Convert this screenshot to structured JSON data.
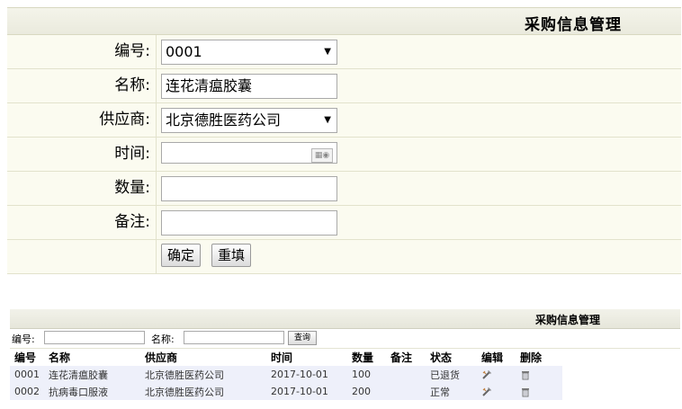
{
  "form": {
    "title": "采购信息管理",
    "fields": [
      {
        "label": "编号:",
        "type": "select",
        "value": "0001"
      },
      {
        "label": "名称:",
        "type": "text",
        "value": "连花清瘟胶囊"
      },
      {
        "label": "供应商:",
        "type": "select",
        "value": "北京德胜医药公司"
      },
      {
        "label": "时间:",
        "type": "date",
        "value": ""
      },
      {
        "label": "数量:",
        "type": "text",
        "value": ""
      },
      {
        "label": "备注:",
        "type": "text",
        "value": ""
      }
    ],
    "buttons": {
      "confirm": "确定",
      "reset": "重填"
    }
  },
  "list": {
    "title": "采购信息管理",
    "search": {
      "id_label": "编号:",
      "name_label": "名称:",
      "query_button": "查询"
    },
    "columns": [
      "编号",
      "名称",
      "供应商",
      "时间",
      "数量",
      "备注",
      "状态",
      "编辑",
      "删除"
    ],
    "rows": [
      {
        "id": "0001",
        "name": "连花清瘟胶囊",
        "supplier": "北京德胜医药公司",
        "time": "2017-10-01",
        "qty": "100",
        "note": "",
        "status": "已退货"
      },
      {
        "id": "0002",
        "name": "抗病毒口服液",
        "supplier": "北京德胜医药公司",
        "time": "2017-10-01",
        "qty": "200",
        "note": "",
        "status": "正常"
      }
    ]
  },
  "icons": {
    "select_arrow": "chevron-down-icon",
    "date_picker": "calendar-icon",
    "edit": "edit-icon",
    "delete": "trash-icon"
  }
}
